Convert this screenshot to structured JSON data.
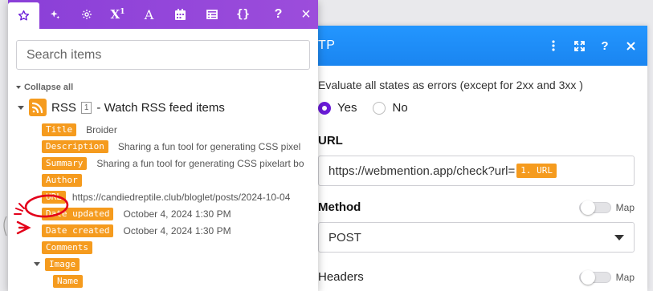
{
  "panel": {
    "title": "TP",
    "actions": [
      "more-vertical-icon",
      "expand-icon",
      "help-icon",
      "close-icon"
    ],
    "error_text": "Evaluate all states as errors (except for 2xx and 3xx )",
    "radios": [
      {
        "label": "Yes",
        "selected": true
      },
      {
        "label": "No",
        "selected": false
      }
    ],
    "url_label": "URL",
    "url_value": "https://webmention.app/check?url=",
    "url_pill": "1. URL",
    "method_label": "Method",
    "map_label": "Map",
    "method_value": "POST",
    "headers_label": "Headers",
    "headers_map_label": "Map",
    "accent": "#1e90ff",
    "radio_color": "#6a1bd8"
  },
  "popup": {
    "tabs": [
      "star-icon",
      "sparkle-icon",
      "gear-icon",
      "superscript-icon",
      "text-icon",
      "calendar-icon",
      "table-icon",
      "braces-icon"
    ],
    "help_label": "?",
    "close_label": "×",
    "search_placeholder": "Search items",
    "collapse_label": "Collapse all",
    "module": {
      "name": "RSS",
      "number": "1",
      "description": "- Watch RSS feed items"
    },
    "items": [
      {
        "tag": "Title",
        "value": "Broider"
      },
      {
        "tag": "Description",
        "value": "Sharing a fun tool for generating CSS pixel"
      },
      {
        "tag": "Summary",
        "value": "Sharing a fun tool for generating CSS pixelart bo"
      },
      {
        "tag": "Author",
        "value": ""
      },
      {
        "tag": "URL",
        "value": "https://candiedreptile.club/bloglet/posts/2024-10-04"
      },
      {
        "tag": "Date updated",
        "value": "October 4, 2024 1:30 PM"
      },
      {
        "tag": "Date created",
        "value": "October 4, 2024 1:30 PM"
      },
      {
        "tag": "Comments",
        "value": ""
      }
    ],
    "image_item": {
      "tag": "Image"
    },
    "image_child": {
      "tag": "Name"
    },
    "tab_gradient": [
      "#8a3fd8",
      "#9c4ddb"
    ],
    "tag_color": "#f59b1e"
  }
}
